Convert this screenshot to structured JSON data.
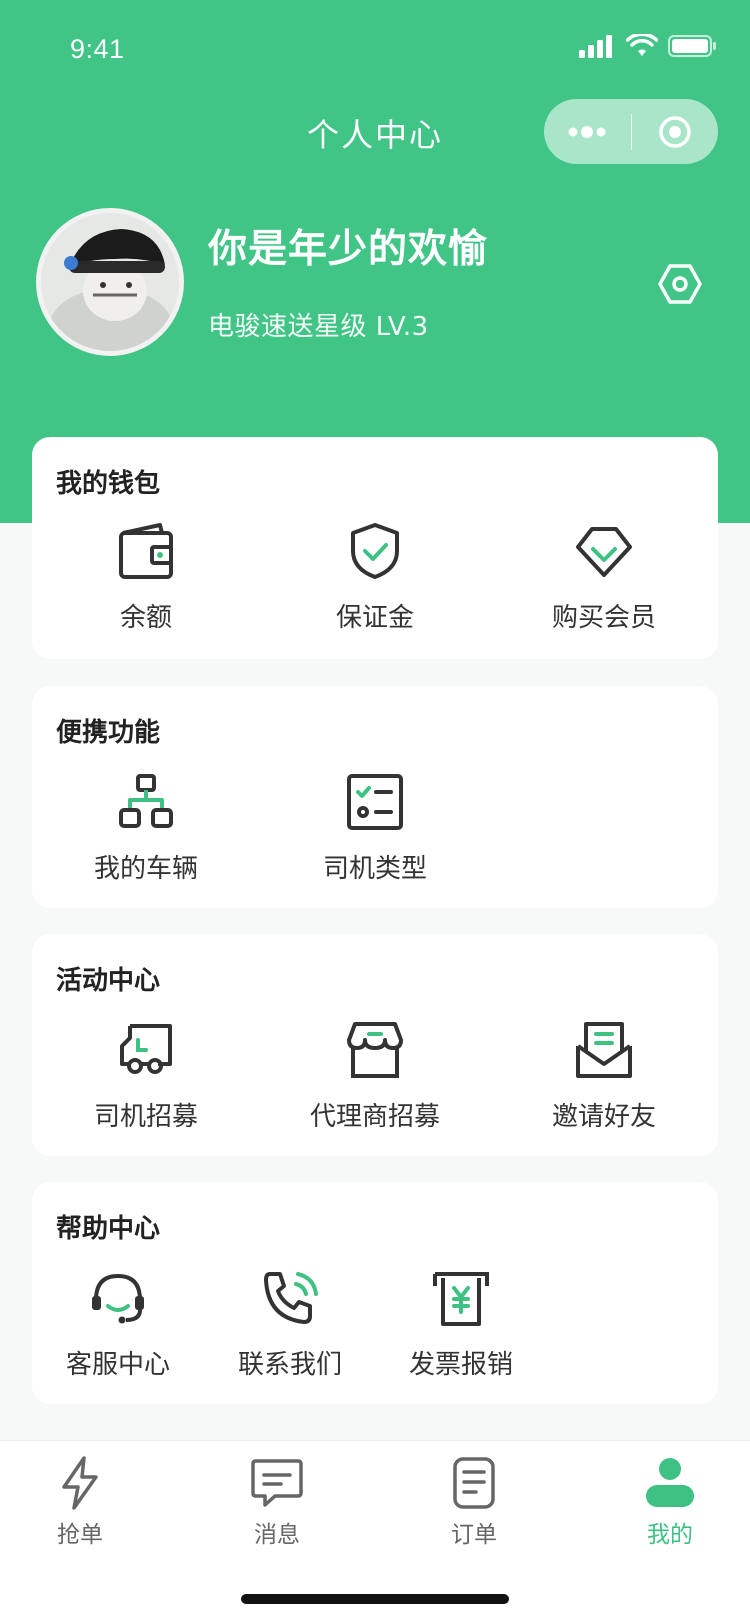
{
  "status_bar": {
    "time": "9:41"
  },
  "nav": {
    "title": "个人中心"
  },
  "profile": {
    "username": "你是年少的欢愉",
    "level": "电骏速送星级 LV.3"
  },
  "sections": {
    "wallet": {
      "title": "我的钱包",
      "items": [
        "余额",
        "保证金",
        "购买会员"
      ]
    },
    "portable": {
      "title": "便携功能",
      "items": [
        "我的车辆",
        "司机类型"
      ]
    },
    "activity": {
      "title": "活动中心",
      "items": [
        "司机招募",
        "代理商招募",
        "邀请好友"
      ]
    },
    "help": {
      "title": "帮助中心",
      "items": [
        "客服中心",
        "联系我们",
        "发票报销"
      ]
    }
  },
  "tabbar": {
    "items": [
      "抢单",
      "消息",
      "订单",
      "我的"
    ],
    "active": "我的"
  },
  "colors": {
    "brand": "#40c587",
    "icon": "#333333",
    "accent": "#3fc184"
  }
}
